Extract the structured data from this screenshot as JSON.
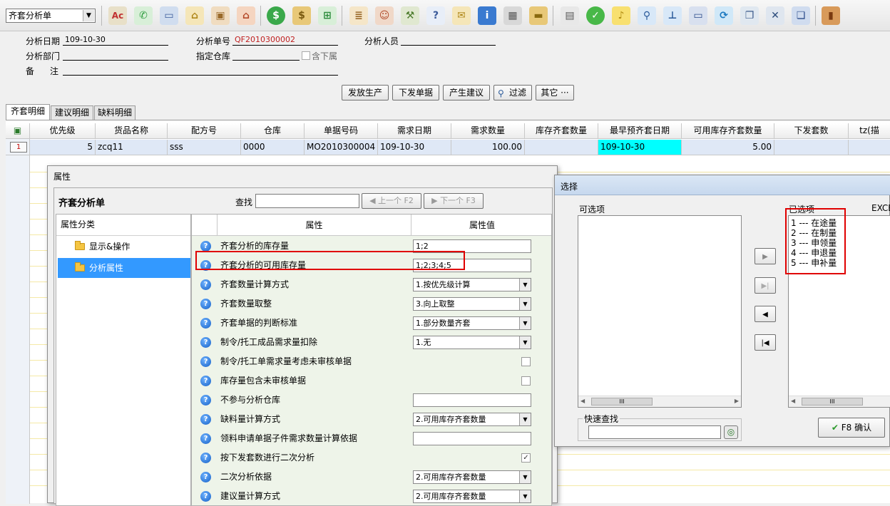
{
  "toolbar": {
    "doc_type": "齐套分析单"
  },
  "header": {
    "analysis_date_label": "分析日期",
    "analysis_date": "109-10-30",
    "analysis_no_label": "分析单号",
    "analysis_no": "QF2010300002",
    "analyst_label": "分析人员",
    "analyst": "",
    "dept_label": "分析部门",
    "dept": "",
    "warehouse_label": "指定仓库",
    "warehouse": "",
    "include_sub_label": "含下属",
    "remark_label1": "备",
    "remark_label2": "注",
    "remark": ""
  },
  "actions": {
    "release": "发放生产",
    "issue": "下发单据",
    "suggest": "产生建议",
    "filter": "过滤",
    "other": "其它 ···"
  },
  "tabs": [
    "齐套明细",
    "建议明细",
    "缺料明细"
  ],
  "grid": {
    "columns": [
      "优先级",
      "货品名称",
      "配方号",
      "仓库",
      "单据号码",
      "需求日期",
      "需求数量",
      "库存齐套数量",
      "最早预齐套日期",
      "可用库存齐套数量",
      "下发套数",
      "tz(描"
    ],
    "rows": [
      {
        "index": "1",
        "priority": "5",
        "item": "zcq11",
        "formula": "sss",
        "warehouse": "0000",
        "doc_no": "MO2010300004",
        "req_date": "109-10-30",
        "req_qty": "100.00",
        "stock_kit_qty": "",
        "earliest_date": "109-10-30",
        "avail_kit_qty": "5.00",
        "issue_sets": ""
      }
    ]
  },
  "prop_dialog": {
    "title": "属性",
    "form_name": "齐套分析单",
    "search_label": "查找",
    "search_value": "",
    "prev_label": "上一个 F2",
    "next_label": "下一个 F3",
    "category_header": "属性分类",
    "categories": [
      "显示&操作",
      "分析属性"
    ],
    "col_prop": "属性",
    "col_value": "属性值",
    "rows": [
      {
        "name": "齐套分析的库存量",
        "value": "1;2"
      },
      {
        "name": "齐套分析的可用库存量",
        "value": "1;2;3;4;5"
      },
      {
        "name": "齐套数量计算方式",
        "value": "1.按优先级计算"
      },
      {
        "name": "齐套数量取整",
        "value": "3.向上取整"
      },
      {
        "name": "齐套单据的判断标准",
        "value": "1.部分数量齐套"
      },
      {
        "name": "制令/托工成品需求量扣除",
        "value": "1.无"
      },
      {
        "name": "制令/托工单需求量考虑未审核单据",
        "value": ""
      },
      {
        "name": "库存量包含未审核单据",
        "value": ""
      },
      {
        "name": "不参与分析仓库",
        "value": ""
      },
      {
        "name": "缺料量计算方式",
        "value": "2.可用库存齐套数量"
      },
      {
        "name": "领料申请单据子件需求数量计算依据",
        "value": ""
      },
      {
        "name": "按下发套数进行二次分析",
        "value": ""
      },
      {
        "name": "二次分析依据",
        "value": "2.可用库存齐套数量"
      },
      {
        "name": "建议量计算方式",
        "value": "2.可用库存齐套数量"
      }
    ]
  },
  "select_dialog": {
    "title": "选择",
    "available_label": "可选项",
    "selected_label": "已选项",
    "excel_label": "EXCE",
    "selected_items": [
      "1 --- 在途量",
      "2 --- 在制量",
      "3 --- 申领量",
      "4 --- 申退量",
      "5 --- 申补量"
    ],
    "quick_search_label": "快速查找",
    "quick_search_value": "",
    "confirm_label": "F8 确认"
  }
}
